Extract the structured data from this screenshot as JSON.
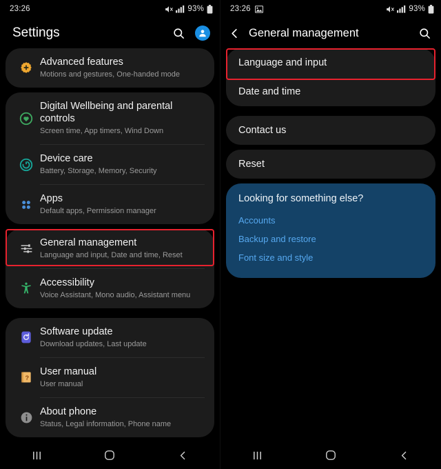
{
  "status_bar": {
    "time": "23:26",
    "battery_pct": "93%",
    "icons": [
      "mute-icon",
      "signal-icon",
      "battery-icon"
    ],
    "right_panel_extra_icon": "screenshot-icon"
  },
  "colors": {
    "highlight": "#e8222e",
    "card_bg": "#1c1c1c",
    "promo_bg": "#144267",
    "promo_link": "#56a8ef",
    "avatar_blue": "#1a8fe3"
  },
  "left_panel": {
    "appbar": {
      "title": "Settings",
      "search_icon": "search-icon",
      "account_icon": "account-avatar-icon"
    },
    "groups": [
      {
        "items": [
          {
            "title": "Advanced features",
            "subtitle": "Motions and gestures, One-handed mode",
            "icon": "advanced-features-icon",
            "highlighted": false
          }
        ]
      },
      {
        "items": [
          {
            "title": "Digital Wellbeing and parental controls",
            "subtitle": "Screen time, App timers, Wind Down",
            "icon": "digital-wellbeing-icon",
            "highlighted": false
          },
          {
            "title": "Device care",
            "subtitle": "Battery, Storage, Memory, Security",
            "icon": "device-care-icon",
            "highlighted": false
          },
          {
            "title": "Apps",
            "subtitle": "Default apps, Permission manager",
            "icon": "apps-icon",
            "highlighted": false
          }
        ]
      },
      {
        "items": [
          {
            "title": "General management",
            "subtitle": "Language and input, Date and time, Reset",
            "icon": "general-management-icon",
            "highlighted": true
          },
          {
            "title": "Accessibility",
            "subtitle": "Voice Assistant, Mono audio, Assistant menu",
            "icon": "accessibility-icon",
            "highlighted": false
          }
        ]
      },
      {
        "items": [
          {
            "title": "Software update",
            "subtitle": "Download updates, Last update",
            "icon": "software-update-icon",
            "highlighted": false
          },
          {
            "title": "User manual",
            "subtitle": "User manual",
            "icon": "user-manual-icon",
            "highlighted": false
          },
          {
            "title": "About phone",
            "subtitle": "Status, Legal information, Phone name",
            "icon": "about-phone-icon",
            "highlighted": false
          }
        ]
      }
    ]
  },
  "right_panel": {
    "appbar": {
      "title": "General management",
      "back_icon": "back-arrow-icon",
      "search_icon": "search-icon"
    },
    "group_one": [
      {
        "label": "Language and input",
        "highlighted": true
      },
      {
        "label": "Date and time",
        "highlighted": false
      }
    ],
    "standalone": [
      {
        "label": "Contact us"
      },
      {
        "label": "Reset"
      }
    ],
    "promo": {
      "title": "Looking for something else?",
      "links": [
        "Accounts",
        "Backup and restore",
        "Font size and style"
      ]
    }
  },
  "nav_bar": {
    "recents": "recents-icon",
    "home": "home-icon",
    "back": "back-icon"
  }
}
